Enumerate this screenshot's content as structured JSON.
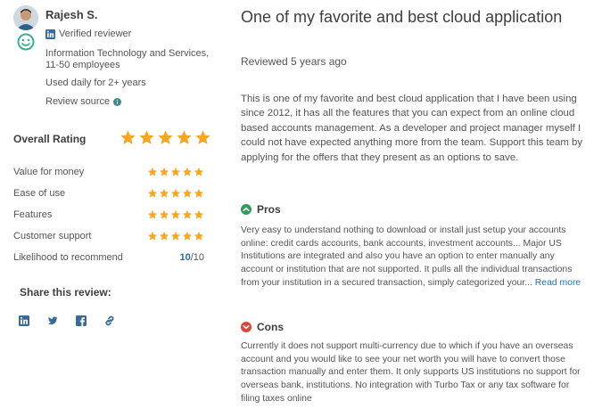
{
  "reviewer": {
    "name": "Rajesh S.",
    "verified_label": "Verified reviewer",
    "industry": "Information Technology and Services, 11-50 employees",
    "usage": "Used daily for 2+ years",
    "source_label": "Review source"
  },
  "ratings": {
    "overall_label": "Overall Rating",
    "overall_stars": 5,
    "items": [
      {
        "label": "Value for money",
        "stars": 5
      },
      {
        "label": "Ease of use",
        "stars": 5
      },
      {
        "label": "Features",
        "stars": 5
      },
      {
        "label": "Customer support",
        "stars": 5
      }
    ],
    "recommend_label": "Likelihood to recommend",
    "recommend_score": "10",
    "recommend_total": "/10"
  },
  "share": {
    "label": "Share this review:",
    "icons": [
      "linkedin-icon",
      "twitter-icon",
      "facebook-icon",
      "link-icon"
    ]
  },
  "review": {
    "title": "One of my favorite and best cloud application",
    "reviewed": "Reviewed 5 years ago",
    "body": "This is one of my favorite and best cloud application that I have been using since 2012, it has all the features that you can expect from an online cloud based accounts management. As a developer and project manager myself I could not have expected anything more from the team. Support this team by applying for the offers that they present as an options to save.",
    "pros_label": "Pros",
    "pros_text": "Very easy to understand nothing to download or install just setup your accounts online: credit cards accounts, bank accounts, investment accounts... Major US Institutions are integrated and also you have an option to enter manually any account or institution that are not supported. It pulls all the individual transactions from your institution in a secured transaction, simply categorized your...",
    "read_more": "Read more",
    "cons_label": "Cons",
    "cons_text": "Currently it does not support multi-currency due to which if you have an overseas account and you would like to see your net worth you will have to convert those transaction manually and enter them. It only supports US institutions no support for overseas bank, institutions. No integration with Turbo Tax or any tax software for filing taxes online"
  },
  "colors": {
    "star": "#f5a623",
    "pros": "#2e9c5a",
    "cons": "#d9473b",
    "link": "#1a73c0",
    "badge": "#3bb08f"
  }
}
